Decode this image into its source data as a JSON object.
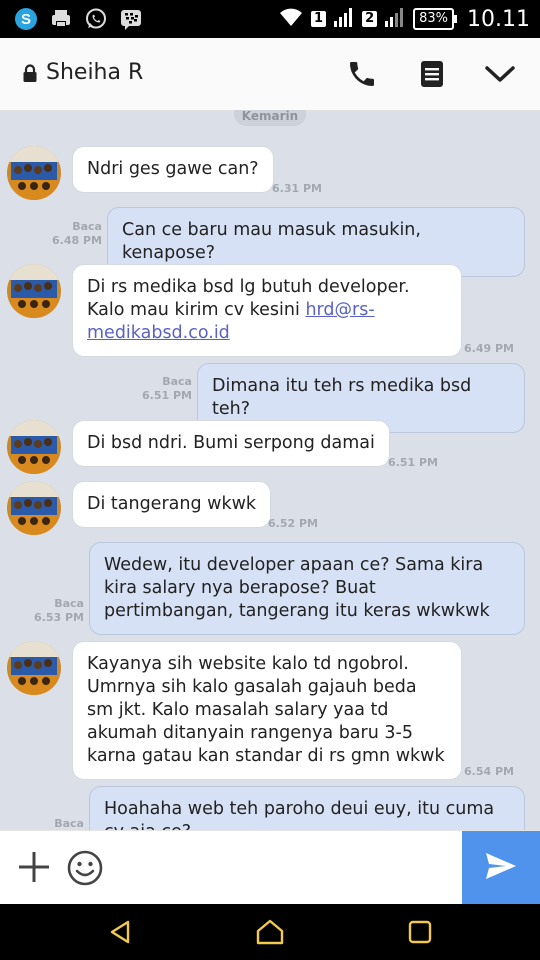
{
  "status_bar": {
    "time": "10.11",
    "battery": "83%",
    "sim1": "1",
    "sim2": "2",
    "icons": [
      "skype-icon",
      "printer-icon",
      "whatsapp-icon",
      "bbm-icon",
      "wifi-icon",
      "signal-icon",
      "battery-icon"
    ]
  },
  "header": {
    "contact_name": "Sheiha R",
    "icons": [
      "lock-icon",
      "phone-icon",
      "menu-icon",
      "chevron-down-icon"
    ]
  },
  "chat": {
    "date_label": "Kemarin",
    "read_label": "Baca",
    "messages": [
      {
        "dir": "in",
        "text": "Ndri ges gawe can?",
        "time": "6.31 PM"
      },
      {
        "dir": "out",
        "text": "Can ce baru mau masuk masukin, kenapose?",
        "time": "6.48 PM"
      },
      {
        "dir": "in",
        "text_before": "Di rs medika bsd lg butuh developer. Kalo mau kirim cv kesini ",
        "link": "hrd@rs-medikabsd.co.id",
        "time": "6.49 PM"
      },
      {
        "dir": "out",
        "text": "Dimana itu teh rs medika bsd teh?",
        "time": "6.51 PM"
      },
      {
        "dir": "in",
        "text": "Di bsd ndri. Bumi serpong damai",
        "time": "6.51 PM"
      },
      {
        "dir": "in",
        "text": "Di tangerang wkwk",
        "time": "6.52 PM"
      },
      {
        "dir": "out",
        "text": "Wedew, itu developer apaan ce? Sama kira kira salary nya berapose? Buat pertimbangan, tangerang itu keras wkwkwk",
        "time": "6.53 PM"
      },
      {
        "dir": "in",
        "text": "Kayanya sih website kalo td ngobrol. Umrnya sih kalo gasalah gajauh beda sm jkt. Kalo masalah salary yaa td akumah ditanyain rangenya baru 3-5 karna gatau kan standar di rs gmn wkwk",
        "time": "6.54 PM"
      },
      {
        "dir": "out",
        "text": "Hoahaha web teh paroho deui euy, itu cuma cv aja ce?"
      }
    ]
  },
  "input_bar": {
    "icons": [
      "plus-icon",
      "emoji-icon",
      "send-icon"
    ],
    "colors": {
      "send": "#4f93ec"
    }
  },
  "nav_bar": {
    "icons": [
      "back-icon",
      "home-icon",
      "recents-icon"
    ],
    "color": "#f2c94c"
  },
  "colors": {
    "background": "#dbe0e8",
    "incoming_bubble": "#ffffff",
    "outgoing_bubble": "#d6e1f5",
    "timestamp": "#a3a8b0"
  }
}
